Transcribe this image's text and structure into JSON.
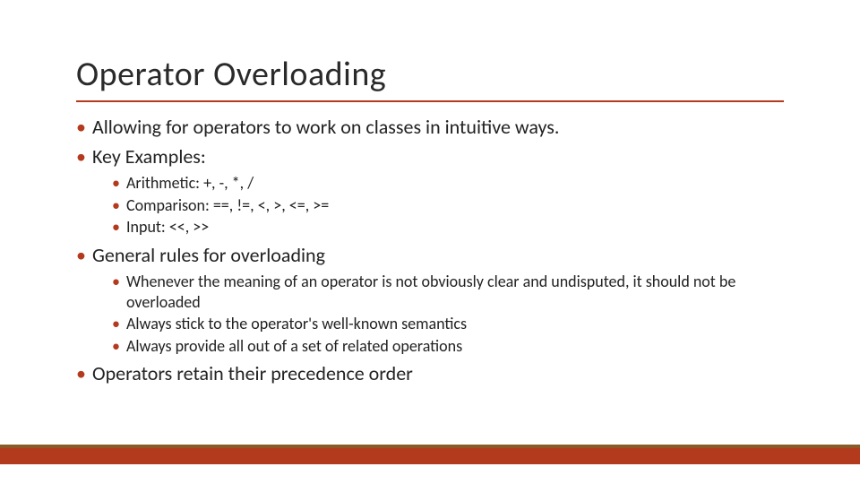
{
  "title": "Operator Overloading",
  "bullets": {
    "b0": "Allowing for operators to work on classes in intuitive ways.",
    "b1": "Key Examples:",
    "b1_sub": {
      "s0": "Arithmetic:  +, -, *, /",
      "s1": "Comparison:  ==, !=, <, >, <=, >=",
      "s2": "Input: <<, >>"
    },
    "b2": "General rules for overloading",
    "b2_sub": {
      "s0": "Whenever the meaning of an operator is not obviously clear and undisputed, it should not be overloaded",
      "s1": "Always stick to the operator's well-known semantics",
      "s2": "Always provide all out of a set of related operations"
    },
    "b3": "Operators retain their precedence order"
  },
  "colors": {
    "accent": "#b43a1e",
    "rule_top": "#8a5a2a"
  }
}
